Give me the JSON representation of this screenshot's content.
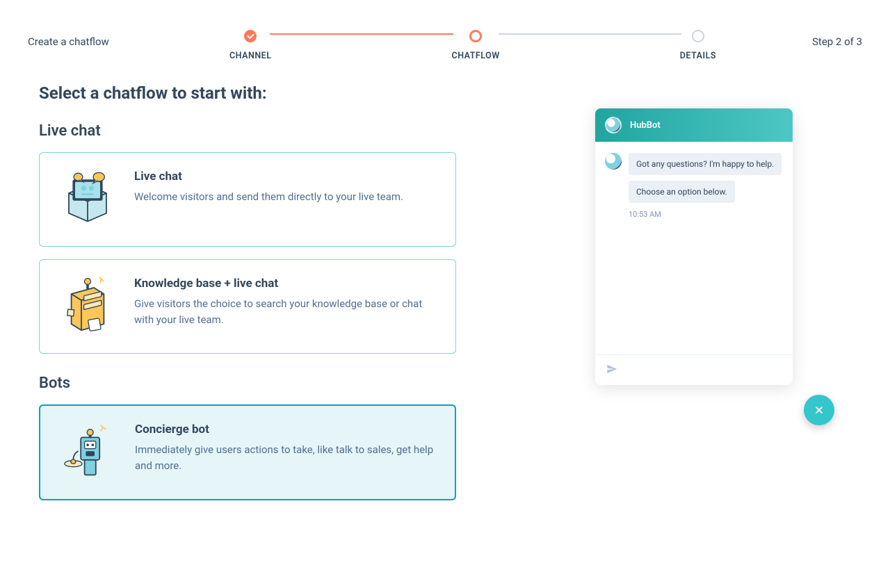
{
  "header": {
    "title": "Create a chatflow",
    "step_count": "Step 2 of 3",
    "steps": {
      "channel": "CHANNEL",
      "chatflow": "CHATFLOW",
      "details": "DETAILS"
    }
  },
  "main": {
    "heading": "Select a chatflow to start with:",
    "live_chat_section": "Live chat",
    "bots_section": "Bots",
    "cards": {
      "live_chat": {
        "title": "Live chat",
        "desc": "Welcome visitors and send them directly to your live team."
      },
      "kb_live_chat": {
        "title": "Knowledge base + live chat",
        "desc": "Give visitors the choice to search your knowledge base or chat with your live team."
      },
      "concierge": {
        "title": "Concierge bot",
        "desc": "Immediately give users actions to take, like talk to sales, get help and more."
      }
    }
  },
  "preview": {
    "bot_name": "HubBot",
    "msg1": "Got any questions? I'm happy to help.",
    "msg2": "Choose an option below.",
    "timestamp": "10:53 AM"
  }
}
